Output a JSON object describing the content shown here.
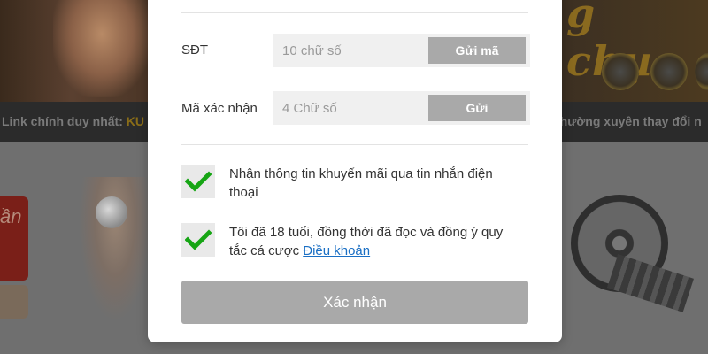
{
  "background": {
    "marquee_left_prefix": "Link chính duy nhất: ",
    "marquee_left_highlight": "KU",
    "marquee_right": "thường xuyên thay đổi n",
    "hero_title_fragment": "g chục",
    "side_tag_text": "ần"
  },
  "form": {
    "phone": {
      "label": "SĐT",
      "placeholder": "10 chữ số",
      "value": "",
      "button": "Gửi mã"
    },
    "code": {
      "label": "Mã xác nhận",
      "placeholder": "4 Chữ số",
      "value": "",
      "button": "Gửi"
    },
    "checkboxes": [
      {
        "text": "Nhận thông tin khuyến mãi qua tin nhắn điện thoại",
        "checked": true
      },
      {
        "text": "Tôi đã 18 tuổi, đồng thời đã đọc và đồng ý quy tắc cá cược ",
        "link_text": "Điều khoản",
        "checked": true
      }
    ],
    "submit": "Xác nhận"
  },
  "colors": {
    "check_green": "#16a514",
    "button_gray": "#a9a9a9",
    "link_blue": "#1a6fc4"
  },
  "icons": {
    "checkmark": "check-icon"
  }
}
